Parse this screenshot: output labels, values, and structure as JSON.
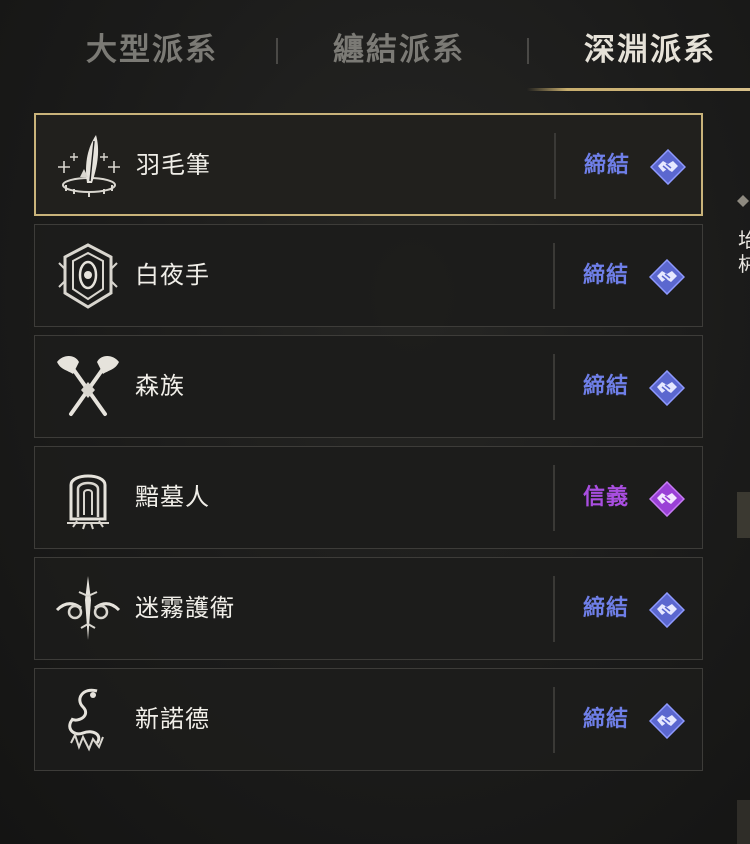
{
  "tabs": [
    {
      "label": "大型派系",
      "active": false
    },
    {
      "label": "纏結派系",
      "active": false
    },
    {
      "label": "深淵派系",
      "active": true
    }
  ],
  "colors": {
    "accent_gold": "#c9b37a",
    "bond_blue": "#6f7fe8",
    "loyal_purple": "#a94ee0"
  },
  "factions": [
    {
      "name": "羽毛筆",
      "status": "締結",
      "status_type": "bond",
      "emblem": "quill-emblem-icon",
      "selected": true
    },
    {
      "name": "白夜手",
      "status": "締結",
      "status_type": "bond",
      "emblem": "white-night-hand-emblem-icon",
      "selected": false
    },
    {
      "name": "森族",
      "status": "締結",
      "status_type": "bond",
      "emblem": "crossed-axes-emblem-icon",
      "selected": false
    },
    {
      "name": "黯墓人",
      "status": "信義",
      "status_type": "loyal",
      "emblem": "dark-tomb-emblem-icon",
      "selected": false
    },
    {
      "name": "迷霧護衛",
      "status": "締結",
      "status_type": "bond",
      "emblem": "mist-guard-emblem-icon",
      "selected": false
    },
    {
      "name": "新諾德",
      "status": "締結",
      "status_type": "bond",
      "emblem": "new-nord-emblem-icon",
      "selected": false
    }
  ],
  "side_fragment": {
    "text": "坮 枾"
  }
}
